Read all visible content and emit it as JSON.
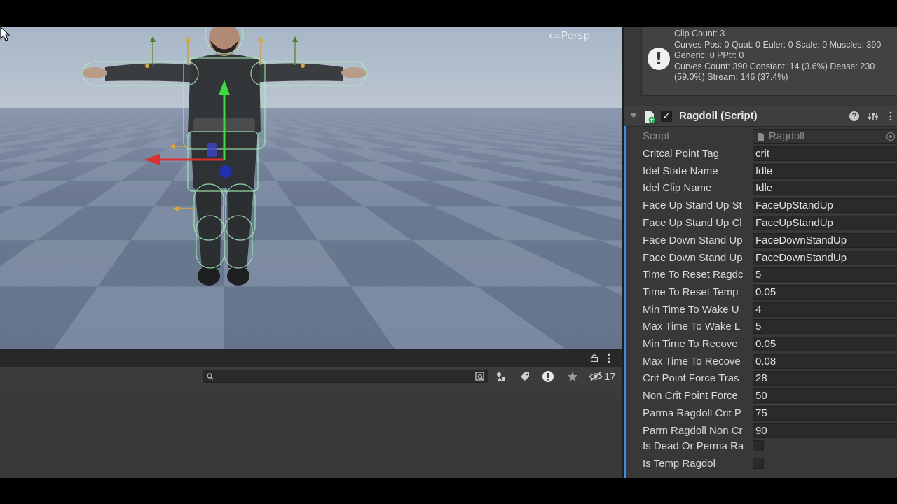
{
  "scene": {
    "persp_label": "‹≡Persp"
  },
  "bottom_panel": {
    "search_placeholder": "",
    "hidden_count": "17"
  },
  "inspector": {
    "clip_info": [
      "Clip Count: 3",
      "Curves Pos: 0 Quat: 0 Euler: 0 Scale: 0 Muscles: 390 Generic: 0 PPtr: 0",
      "Curves Count: 390 Constant: 14 (3.6%) Dense: 230 (59.0%) Stream: 146 (37.4%)"
    ],
    "component": {
      "title": "Ragdoll (Script)",
      "enabled": true
    },
    "properties": [
      {
        "label": "Script",
        "type": "object",
        "value": "Ragdoll"
      },
      {
        "label": "Critcal Point Tag",
        "type": "text",
        "value": "crit"
      },
      {
        "label": "Idel State Name",
        "type": "text",
        "value": "Idle"
      },
      {
        "label": "Idel Clip Name",
        "type": "text",
        "value": "Idle"
      },
      {
        "label": "Face Up Stand Up St",
        "type": "text",
        "value": "FaceUpStandUp"
      },
      {
        "label": "Face Up Stand Up Cl",
        "type": "text",
        "value": "FaceUpStandUp"
      },
      {
        "label": "Face Down Stand Up",
        "type": "text",
        "value": "FaceDownStandUp"
      },
      {
        "label": "Face Down Stand Up",
        "type": "text",
        "value": "FaceDownStandUp"
      },
      {
        "label": "Time To Reset Ragdc",
        "type": "text",
        "value": "5"
      },
      {
        "label": "Time To Reset Temp",
        "type": "text",
        "value": "0.05"
      },
      {
        "label": "Min Time To Wake U",
        "type": "text",
        "value": "4"
      },
      {
        "label": "Max Time To Wake L",
        "type": "text",
        "value": "5"
      },
      {
        "label": "Min Time To Recove",
        "type": "text",
        "value": "0.05"
      },
      {
        "label": "Max Time To Recove",
        "type": "text",
        "value": "0.08"
      },
      {
        "label": "Crit Point Force Tras",
        "type": "text",
        "value": "28"
      },
      {
        "label": "Non Crit Point Force",
        "type": "text",
        "value": "50"
      },
      {
        "label": "Parma Ragdoll Crit P",
        "type": "text",
        "value": "75"
      },
      {
        "label": "Parm Ragdoll Non Cr",
        "type": "text",
        "value": "90"
      },
      {
        "label": "Is Dead Or Perma Ra",
        "type": "bool",
        "value": false
      },
      {
        "label": "Is Temp Ragdol",
        "type": "bool",
        "value": false
      }
    ]
  },
  "colors": {
    "accent": "#3d8ee0",
    "panel": "#383838",
    "field": "#2a2a2a"
  }
}
